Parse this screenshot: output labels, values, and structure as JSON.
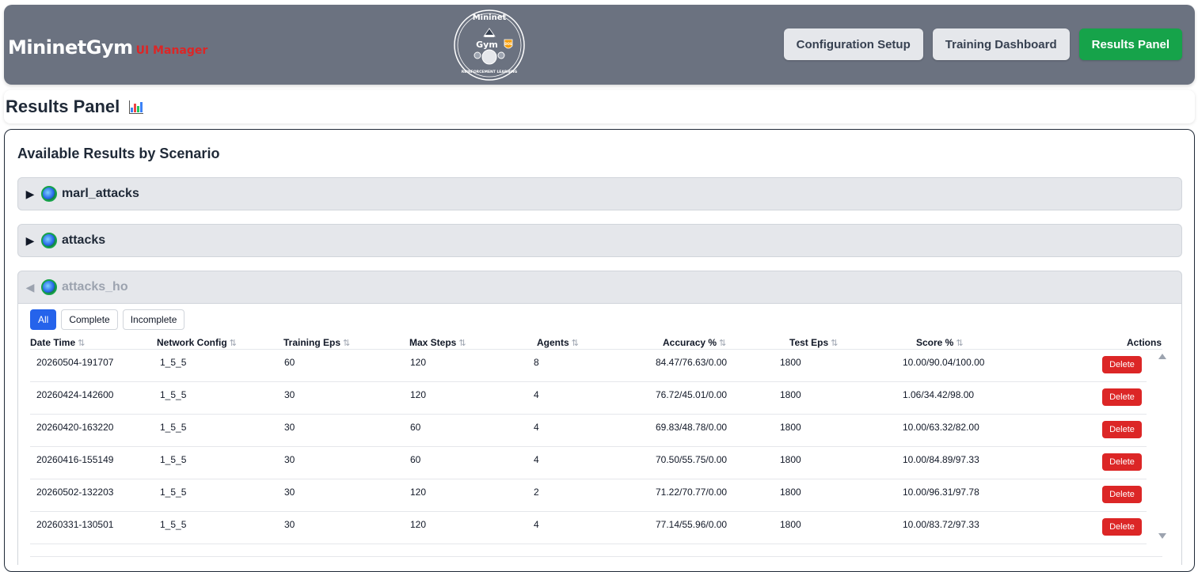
{
  "header": {
    "brand_title": "MininetGym",
    "brand_sub": "UI Manager",
    "logo": {
      "top": "Mininet",
      "middle": "Gym",
      "badge": "DOS",
      "bottom": "REINFORCEMENT LEARNING"
    },
    "nav": [
      {
        "label": "Configuration Setup",
        "active": false
      },
      {
        "label": "Training Dashboard",
        "active": false
      },
      {
        "label": "Results Panel",
        "active": true
      }
    ]
  },
  "page": {
    "title": "Results Panel",
    "title_icon": "bar-chart-icon"
  },
  "results": {
    "heading": "Available Results by Scenario",
    "scenarios": [
      {
        "name": "marl_attacks",
        "expanded": false
      },
      {
        "name": "attacks",
        "expanded": false
      },
      {
        "name": "attacks_ho",
        "expanded": true
      }
    ],
    "filters": [
      {
        "label": "All",
        "active": true
      },
      {
        "label": "Complete",
        "active": false
      },
      {
        "label": "Incomplete",
        "active": false
      }
    ],
    "columns": [
      "Date Time",
      "Network Config",
      "Training Eps",
      "Max Steps",
      "Agents",
      "Accuracy %",
      "Test Eps",
      "Score %",
      "Actions"
    ],
    "sort_glyph": "⇅",
    "delete_label": "Delete",
    "rows": [
      {
        "datetime": "20260504-191707",
        "network": "1_5_5",
        "training_eps": "60",
        "max_steps": "120",
        "agents": "8",
        "accuracy": "84.47/76.63/0.00",
        "test_eps": "1800",
        "score": "10.00/90.04/100.00"
      },
      {
        "datetime": "20260424-142600",
        "network": "1_5_5",
        "training_eps": "30",
        "max_steps": "120",
        "agents": "4",
        "accuracy": "76.72/45.01/0.00",
        "test_eps": "1800",
        "score": "1.06/34.42/98.00"
      },
      {
        "datetime": "20260420-163220",
        "network": "1_5_5",
        "training_eps": "30",
        "max_steps": "60",
        "agents": "4",
        "accuracy": "69.83/48.78/0.00",
        "test_eps": "1800",
        "score": "10.00/63.32/82.00"
      },
      {
        "datetime": "20260416-155149",
        "network": "1_5_5",
        "training_eps": "30",
        "max_steps": "60",
        "agents": "4",
        "accuracy": "70.50/55.75/0.00",
        "test_eps": "1800",
        "score": "10.00/84.89/97.33"
      },
      {
        "datetime": "20260502-132203",
        "network": "1_5_5",
        "training_eps": "30",
        "max_steps": "120",
        "agents": "2",
        "accuracy": "71.22/70.77/0.00",
        "test_eps": "1800",
        "score": "10.00/96.31/97.78"
      },
      {
        "datetime": "20260331-130501",
        "network": "1_5_5",
        "training_eps": "30",
        "max_steps": "120",
        "agents": "4",
        "accuracy": "77.14/55.96/0.00",
        "test_eps": "1800",
        "score": "10.00/83.72/97.33"
      }
    ],
    "colors": {
      "delete": "#dc2626",
      "active_filter": "#2563eb",
      "active_nav": "#16a34a"
    }
  }
}
